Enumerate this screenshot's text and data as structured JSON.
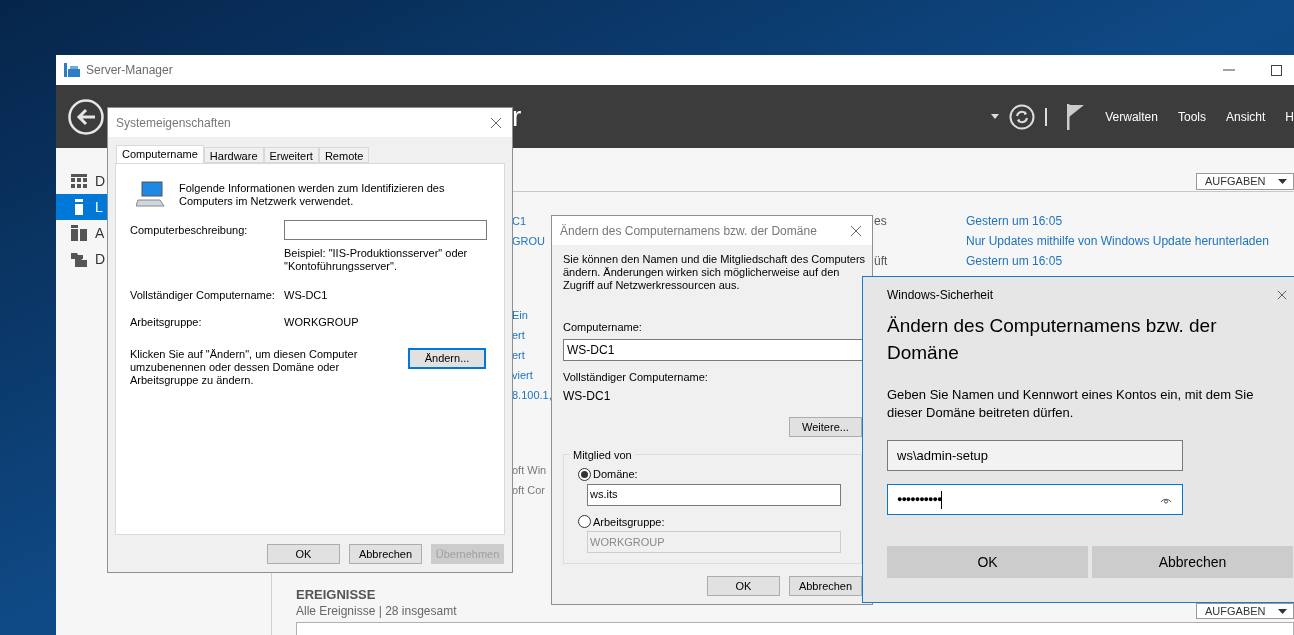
{
  "server_manager": {
    "title": "Server-Manager",
    "header": {
      "title_fragment": "r",
      "menu": [
        "Verwalten",
        "Tools",
        "Ansicht",
        "H"
      ]
    },
    "sidebar": {
      "items": [
        {
          "label": "D",
          "selected": false,
          "kind": "dashboard"
        },
        {
          "label": "L",
          "selected": true,
          "kind": "local"
        },
        {
          "label": "A",
          "selected": false,
          "kind": "all"
        },
        {
          "label": "D",
          "selected": false,
          "kind": "files"
        }
      ]
    },
    "properties": {
      "tasks_button": "AUFGABEN",
      "groups": [
        {
          "kind": "link",
          "rows": [
            {
              "column_1": "C1",
              "column_2": "es",
              "column_3": "Gestern um 16:05"
            },
            {
              "column_1": "GROU",
              "column_3": "Nur Updates mithilfe von Windows Update herunterladen"
            },
            {
              "column_2": "üft",
              "column_3": "Gestern um 16:05"
            }
          ]
        },
        {
          "kind": "link",
          "rows": [
            {
              "column_1": "Ein"
            },
            {
              "column_1": "ert"
            },
            {
              "column_1": "ert"
            },
            {
              "column_1": "viert"
            },
            {
              "column_1": "8.100.1,"
            }
          ]
        },
        {
          "kind": "text",
          "rows": [
            {
              "column_1": "oft Win"
            },
            {
              "column_1": "oft Cor"
            }
          ]
        }
      ]
    },
    "events": {
      "title": "EREIGNISSE",
      "subtitle": "Alle Ereignisse | 28 insgesamt",
      "tasks_button": "AUFGABEN"
    }
  },
  "system_properties": {
    "title": "Systemeigenschaften",
    "tabs": [
      {
        "label": "Computername",
        "selected": true
      },
      {
        "label": "Hardware",
        "selected": false
      },
      {
        "label": "Erweitert",
        "selected": false
      },
      {
        "label": "Remote",
        "selected": false
      }
    ],
    "intro": "Folgende Informationen werden zum Identifizieren des Computers im Netzwerk verwendet.",
    "description_label": "Computerbeschreibung:",
    "example": "Beispiel: \"IIS-Produktionsserver\" oder \"Kontoführungsserver\".",
    "full_name_label": "Vollständiger Computername:",
    "full_name_value": "WS-DC1",
    "workgroup_label": "Arbeitsgruppe:",
    "workgroup_value": "WORKGROUP",
    "change_hint": "Klicken Sie auf \"Ändern\", um diesen Computer umzubenennen oder dessen Domäne oder Arbeitsgruppe zu ändern.",
    "change_button": "Ändern...",
    "buttons": [
      {
        "label": "OK",
        "disabled": false
      },
      {
        "label": "Abbrechen",
        "disabled": false
      },
      {
        "label": "Übernehmen",
        "disabled": true
      }
    ]
  },
  "change_dialog": {
    "title": "Ändern des Computernamens bzw. der Domäne",
    "intro": "Sie können den Namen und die Mitgliedschaft des Computers ändern. Änderungen wirken sich möglicherweise auf den Zugriff auf Netzwerkressourcen aus.",
    "computer_name_label": "Computername:",
    "computer_name_value": "WS-DC1",
    "full_name_label": "Vollständiger Computername:",
    "full_name_value": "WS-DC1",
    "more_button": "Weitere...",
    "member_of": {
      "title": "Mitglied von",
      "options": [
        {
          "label": "Domäne:",
          "selected": true,
          "value": "ws.its"
        },
        {
          "label": "Arbeitsgruppe:",
          "selected": false,
          "value": "WORKGROUP"
        }
      ]
    },
    "buttons": [
      "OK",
      "Abbrechen"
    ]
  },
  "security_dialog": {
    "title": "Windows-Sicherheit",
    "heading": "Ändern des Computernamens bzw. der Domäne",
    "message": "Geben Sie Namen und Kennwort eines Kontos ein, mit dem Sie dieser Domäne beitreten dürfen.",
    "username": "ws\\admin-setup",
    "password": "●●●●●●●●●●",
    "buttons": [
      "OK",
      "Abbrechen"
    ]
  }
}
